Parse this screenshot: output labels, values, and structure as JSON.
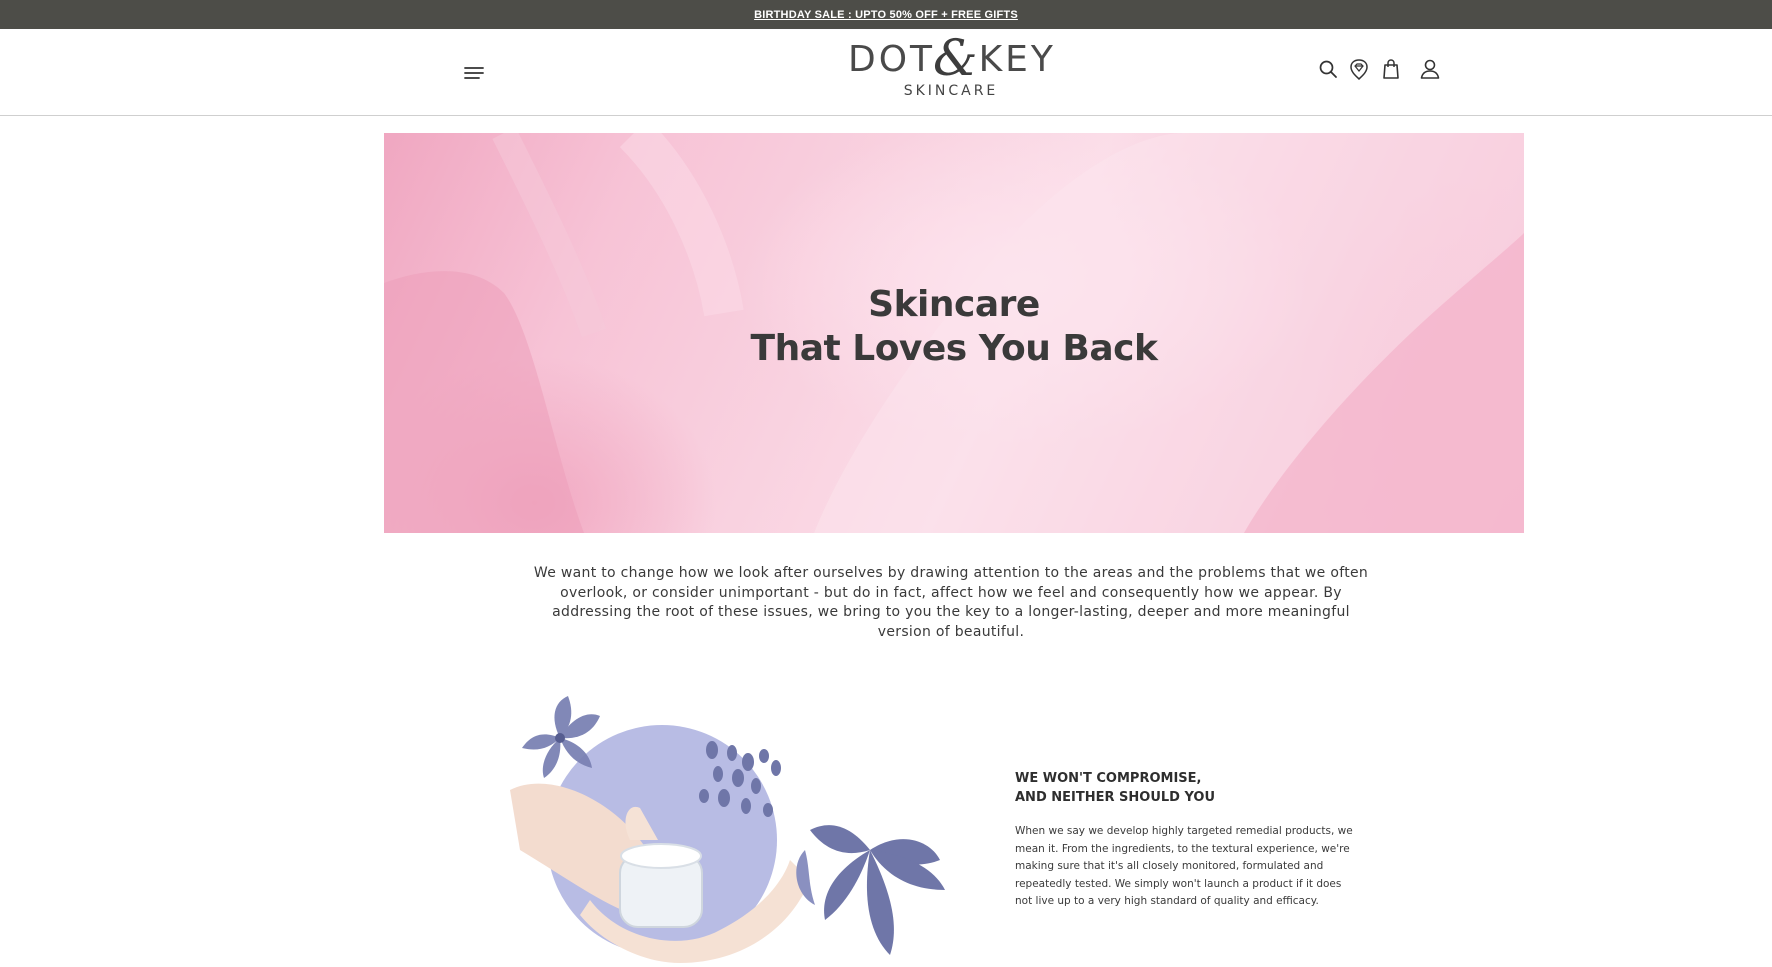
{
  "announcement": {
    "text": "BIRTHDAY SALE : UPTO 50% OFF + FREE GIFTS"
  },
  "header": {
    "logo_main_left": "DOT",
    "logo_amp": "&",
    "logo_main_right": "KEY",
    "logo_sub": "SKINCARE",
    "icons": [
      "menu-icon",
      "search-icon",
      "rewards-diamond-icon",
      "cart-bag-icon",
      "account-icon"
    ]
  },
  "hero": {
    "title_line1": "Skincare",
    "title_line2": "That Loves You Back"
  },
  "intro": {
    "text": "We want to change how we look after ourselves by drawing attention to the areas and the problems that we often overlook, or consider unimportant - but do in fact, affect how we feel and consequently how we appear. By addressing the root of these issues, we bring to you the key to a longer-lasting, deeper and more meaningful version of beautiful."
  },
  "feature": {
    "title_line1": "WE WON'T COMPROMISE,",
    "title_line2": "AND NEITHER SHOULD YOU",
    "body": "When we say we develop highly targeted remedial products, we mean it. From the ingredients, to the textural experience, we're making sure that it's all closely monitored, formulated and repeatedly tested. We simply won't launch a product if it does not live up to a very high standard of quality and efficacy."
  },
  "colors": {
    "announcement_bg": "#4d4d48",
    "hero_pink": "#f4b4cb",
    "text_dark": "#3a3a3a",
    "illustration_lavender": "#b8bce4",
    "illustration_flower": "#6f76a8"
  }
}
